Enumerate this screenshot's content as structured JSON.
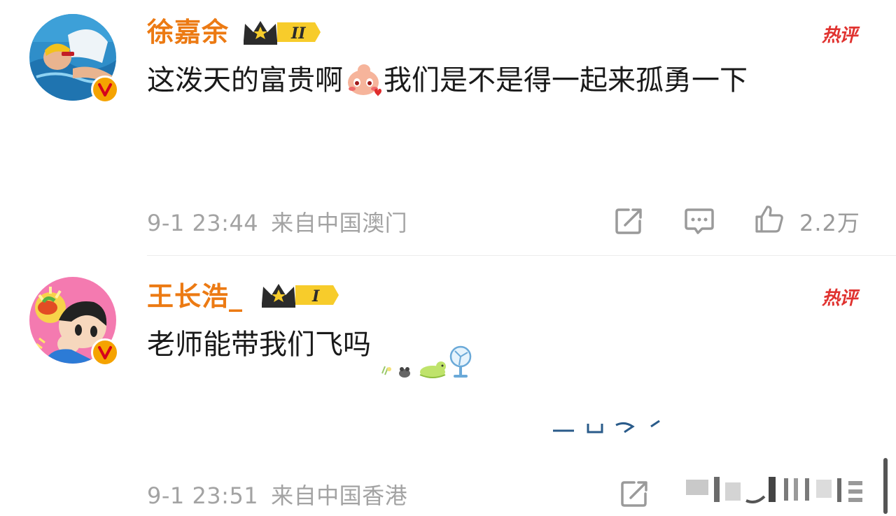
{
  "comments": [
    {
      "username": "徐嘉余",
      "level_badge": "II",
      "hot_label": "热评",
      "text_before_emoji": "这泼天的富贵啊",
      "text_after_emoji": "我们是不是得一起来孤勇一下",
      "timestamp": "9-1 23:44",
      "location": "来自中国澳门",
      "like_count": "2.2万"
    },
    {
      "username": "王长浩_",
      "level_badge": "I",
      "hot_label": "热评",
      "text": "老师能带我们飞吗",
      "timestamp": "9-1 23:51",
      "location": "来自中国香港"
    }
  ],
  "colors": {
    "username": "#ec7a13",
    "hot_label": "#e0322f",
    "verified_badge": "#f5a300",
    "meta_text": "#a3a3a3"
  },
  "icons": [
    "share-icon",
    "reply-icon",
    "like-icon",
    "crown-icon",
    "verified-icon"
  ]
}
